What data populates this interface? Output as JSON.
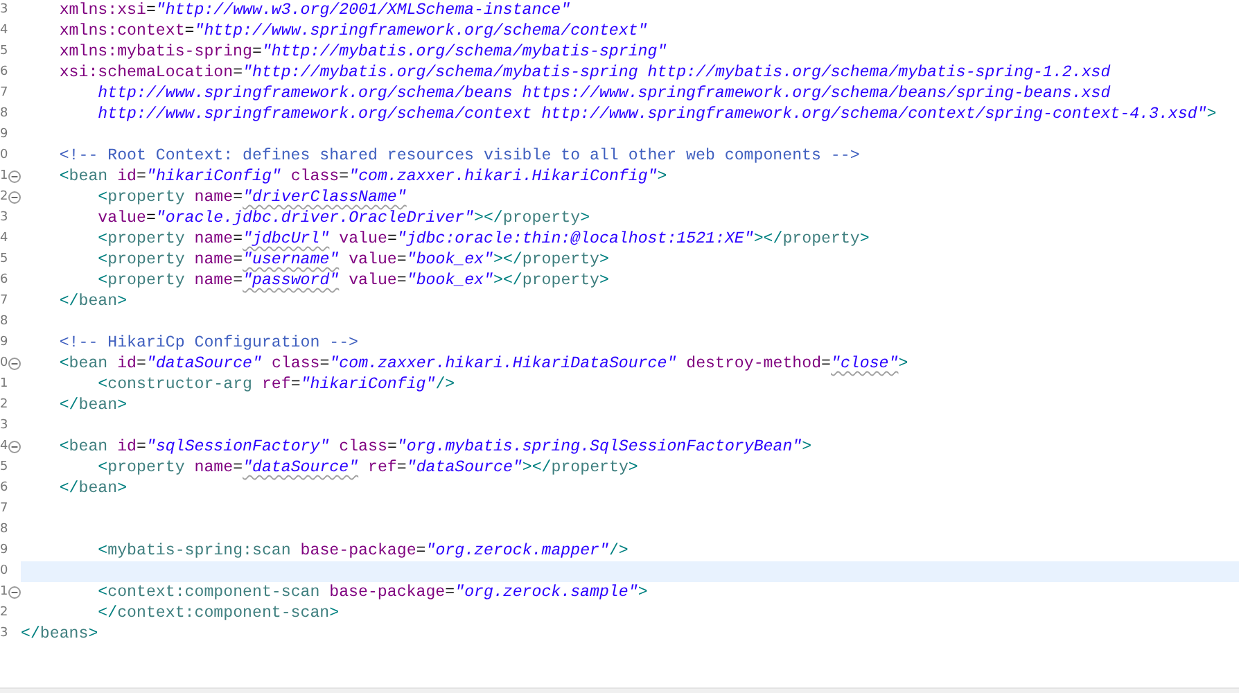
{
  "editor": {
    "lines": [
      {
        "number": "3",
        "foldable": false,
        "current": false,
        "tokens": [
          {
            "kind": "attr",
            "text": "    xmlns:xsi"
          },
          {
            "kind": "plain",
            "text": "="
          },
          {
            "kind": "value",
            "text": "\"http://www.w3.org/2001/XMLSchema-instance\""
          }
        ]
      },
      {
        "number": "4",
        "foldable": false,
        "current": false,
        "tokens": [
          {
            "kind": "attr",
            "text": "    xmlns:context"
          },
          {
            "kind": "plain",
            "text": "="
          },
          {
            "kind": "value",
            "text": "\"http://www.springframework.org/schema/context\""
          }
        ]
      },
      {
        "number": "5",
        "foldable": false,
        "current": false,
        "tokens": [
          {
            "kind": "attr",
            "text": "    xmlns:mybatis-spring"
          },
          {
            "kind": "plain",
            "text": "="
          },
          {
            "kind": "value",
            "text": "\"http://mybatis.org/schema/mybatis-spring\""
          }
        ]
      },
      {
        "number": "6",
        "foldable": false,
        "current": false,
        "tokens": [
          {
            "kind": "attr",
            "text": "    xsi:schemaLocation"
          },
          {
            "kind": "plain",
            "text": "="
          },
          {
            "kind": "value",
            "text": "\"http://mybatis.org/schema/mybatis-spring http://mybatis.org/schema/mybatis-spring-1.2.xsd"
          }
        ]
      },
      {
        "number": "7",
        "foldable": false,
        "current": false,
        "tokens": [
          {
            "kind": "value",
            "text": "        http://www.springframework.org/schema/beans https://www.springframework.org/schema/beans/spring-beans.xsd"
          }
        ]
      },
      {
        "number": "8",
        "foldable": false,
        "current": false,
        "tokens": [
          {
            "kind": "value",
            "text": "        http://www.springframework.org/schema/context http://www.springframework.org/schema/context/spring-context-4.3.xsd\""
          },
          {
            "kind": "bracket",
            "text": ">"
          }
        ]
      },
      {
        "number": "9",
        "foldable": false,
        "current": false
      },
      {
        "number": "0",
        "foldable": false,
        "current": false,
        "tokens": [
          {
            "kind": "comment",
            "text": "    <!-- Root Context: defines shared resources visible to all other web components -->"
          }
        ]
      },
      {
        "number": "1",
        "foldable": true,
        "current": false,
        "tokens": [
          {
            "kind": "bracket",
            "text": "    <"
          },
          {
            "kind": "tag",
            "text": "bean"
          },
          {
            "kind": "attr",
            "text": " id"
          },
          {
            "kind": "plain",
            "text": "="
          },
          {
            "kind": "value",
            "text": "\"hikariConfig\""
          },
          {
            "kind": "attr",
            "text": " class"
          },
          {
            "kind": "plain",
            "text": "="
          },
          {
            "kind": "value",
            "text": "\"com.zaxxer.hikari.HikariConfig\""
          },
          {
            "kind": "bracket",
            "text": ">"
          }
        ]
      },
      {
        "number": "2",
        "foldable": true,
        "current": false,
        "tokens": [
          {
            "kind": "bracket",
            "text": "        <"
          },
          {
            "kind": "tag",
            "text": "property"
          },
          {
            "kind": "attr",
            "text": " name"
          },
          {
            "kind": "plain",
            "text": "="
          },
          {
            "kind": "value",
            "text": "\"driverClassName\"",
            "spell": true
          }
        ]
      },
      {
        "number": "3",
        "foldable": false,
        "current": false,
        "tokens": [
          {
            "kind": "attr",
            "text": "        value"
          },
          {
            "kind": "plain",
            "text": "="
          },
          {
            "kind": "value",
            "text": "\"oracle.jdbc.driver.OracleDriver\""
          },
          {
            "kind": "bracket",
            "text": "></"
          },
          {
            "kind": "tag",
            "text": "property"
          },
          {
            "kind": "bracket",
            "text": ">"
          }
        ]
      },
      {
        "number": "4",
        "foldable": false,
        "current": false,
        "tokens": [
          {
            "kind": "bracket",
            "text": "        <"
          },
          {
            "kind": "tag",
            "text": "property"
          },
          {
            "kind": "attr",
            "text": " name"
          },
          {
            "kind": "plain",
            "text": "="
          },
          {
            "kind": "value",
            "text": "\"jdbcUrl\"",
            "spell": true
          },
          {
            "kind": "attr",
            "text": " value"
          },
          {
            "kind": "plain",
            "text": "="
          },
          {
            "kind": "value",
            "text": "\"jdbc:oracle:thin:@localhost:1521:XE\""
          },
          {
            "kind": "bracket",
            "text": "></"
          },
          {
            "kind": "tag",
            "text": "property"
          },
          {
            "kind": "bracket",
            "text": ">"
          }
        ]
      },
      {
        "number": "5",
        "foldable": false,
        "current": false,
        "tokens": [
          {
            "kind": "bracket",
            "text": "        <"
          },
          {
            "kind": "tag",
            "text": "property"
          },
          {
            "kind": "attr",
            "text": " name"
          },
          {
            "kind": "plain",
            "text": "="
          },
          {
            "kind": "value",
            "text": "\"username\"",
            "spell": true
          },
          {
            "kind": "attr",
            "text": " value"
          },
          {
            "kind": "plain",
            "text": "="
          },
          {
            "kind": "value",
            "text": "\"book_ex\""
          },
          {
            "kind": "bracket",
            "text": "></"
          },
          {
            "kind": "tag",
            "text": "property"
          },
          {
            "kind": "bracket",
            "text": ">"
          }
        ]
      },
      {
        "number": "6",
        "foldable": false,
        "current": false,
        "tokens": [
          {
            "kind": "bracket",
            "text": "        <"
          },
          {
            "kind": "tag",
            "text": "property"
          },
          {
            "kind": "attr",
            "text": " name"
          },
          {
            "kind": "plain",
            "text": "="
          },
          {
            "kind": "value",
            "text": "\"password\"",
            "spell": true
          },
          {
            "kind": "attr",
            "text": " value"
          },
          {
            "kind": "plain",
            "text": "="
          },
          {
            "kind": "value",
            "text": "\"book_ex\""
          },
          {
            "kind": "bracket",
            "text": "></"
          },
          {
            "kind": "tag",
            "text": "property"
          },
          {
            "kind": "bracket",
            "text": ">"
          }
        ]
      },
      {
        "number": "7",
        "foldable": false,
        "current": false,
        "tokens": [
          {
            "kind": "bracket",
            "text": "    </"
          },
          {
            "kind": "tag",
            "text": "bean"
          },
          {
            "kind": "bracket",
            "text": ">"
          }
        ]
      },
      {
        "number": "8",
        "foldable": false,
        "current": false
      },
      {
        "number": "9",
        "foldable": false,
        "current": false,
        "tokens": [
          {
            "kind": "comment",
            "text": "    <!-- HikariCp Configuration -->"
          }
        ]
      },
      {
        "number": "0",
        "foldable": true,
        "current": false,
        "tokens": [
          {
            "kind": "bracket",
            "text": "    <"
          },
          {
            "kind": "tag",
            "text": "bean"
          },
          {
            "kind": "attr",
            "text": " id"
          },
          {
            "kind": "plain",
            "text": "="
          },
          {
            "kind": "value",
            "text": "\"dataSource\""
          },
          {
            "kind": "attr",
            "text": " class"
          },
          {
            "kind": "plain",
            "text": "="
          },
          {
            "kind": "value",
            "text": "\"com.zaxxer.hikari.HikariDataSource\""
          },
          {
            "kind": "attr",
            "text": " destroy-method"
          },
          {
            "kind": "plain",
            "text": "="
          },
          {
            "kind": "value",
            "text": "\"close\"",
            "spell": true
          },
          {
            "kind": "bracket",
            "text": ">"
          }
        ]
      },
      {
        "number": "1",
        "foldable": false,
        "current": false,
        "tokens": [
          {
            "kind": "bracket",
            "text": "        <"
          },
          {
            "kind": "tag",
            "text": "constructor-arg"
          },
          {
            "kind": "attr",
            "text": " ref"
          },
          {
            "kind": "plain",
            "text": "="
          },
          {
            "kind": "value",
            "text": "\"hikariConfig\""
          },
          {
            "kind": "bracket",
            "text": "/>"
          }
        ]
      },
      {
        "number": "2",
        "foldable": false,
        "current": false,
        "tokens": [
          {
            "kind": "bracket",
            "text": "    </"
          },
          {
            "kind": "tag",
            "text": "bean"
          },
          {
            "kind": "bracket",
            "text": ">"
          }
        ]
      },
      {
        "number": "3",
        "foldable": false,
        "current": false
      },
      {
        "number": "4",
        "foldable": true,
        "current": false,
        "tokens": [
          {
            "kind": "bracket",
            "text": "    <"
          },
          {
            "kind": "tag",
            "text": "bean"
          },
          {
            "kind": "attr",
            "text": " id"
          },
          {
            "kind": "plain",
            "text": "="
          },
          {
            "kind": "value",
            "text": "\"sqlSessionFactory\""
          },
          {
            "kind": "attr",
            "text": " class"
          },
          {
            "kind": "plain",
            "text": "="
          },
          {
            "kind": "value",
            "text": "\"org.mybatis.spring.SqlSessionFactoryBean\""
          },
          {
            "kind": "bracket",
            "text": ">"
          }
        ]
      },
      {
        "number": "5",
        "foldable": false,
        "current": false,
        "tokens": [
          {
            "kind": "bracket",
            "text": "        <"
          },
          {
            "kind": "tag",
            "text": "property"
          },
          {
            "kind": "attr",
            "text": " name"
          },
          {
            "kind": "plain",
            "text": "="
          },
          {
            "kind": "value",
            "text": "\"dataSource\"",
            "spell": true
          },
          {
            "kind": "attr",
            "text": " ref"
          },
          {
            "kind": "plain",
            "text": "="
          },
          {
            "kind": "value",
            "text": "\"dataSource\""
          },
          {
            "kind": "bracket",
            "text": "></"
          },
          {
            "kind": "tag",
            "text": "property"
          },
          {
            "kind": "bracket",
            "text": ">"
          }
        ]
      },
      {
        "number": "6",
        "foldable": false,
        "current": false,
        "tokens": [
          {
            "kind": "bracket",
            "text": "    </"
          },
          {
            "kind": "tag",
            "text": "bean"
          },
          {
            "kind": "bracket",
            "text": ">"
          }
        ]
      },
      {
        "number": "7",
        "foldable": false,
        "current": false
      },
      {
        "number": "8",
        "foldable": false,
        "current": false
      },
      {
        "number": "9",
        "foldable": false,
        "current": false,
        "tokens": [
          {
            "kind": "bracket",
            "text": "        <"
          },
          {
            "kind": "tag",
            "text": "mybatis-spring:scan"
          },
          {
            "kind": "attr",
            "text": " base-package"
          },
          {
            "kind": "plain",
            "text": "="
          },
          {
            "kind": "value",
            "text": "\"org.zerock.mapper\""
          },
          {
            "kind": "bracket",
            "text": "/>"
          }
        ]
      },
      {
        "number": "0",
        "foldable": false,
        "current": true
      },
      {
        "number": "1",
        "foldable": true,
        "current": false,
        "tokens": [
          {
            "kind": "bracket",
            "text": "        <"
          },
          {
            "kind": "tag",
            "text": "context:component-scan"
          },
          {
            "kind": "attr",
            "text": " base-package"
          },
          {
            "kind": "plain",
            "text": "="
          },
          {
            "kind": "value",
            "text": "\"org.zerock.sample\""
          },
          {
            "kind": "bracket",
            "text": ">"
          }
        ]
      },
      {
        "number": "2",
        "foldable": false,
        "current": false,
        "tokens": [
          {
            "kind": "bracket",
            "text": "        </"
          },
          {
            "kind": "tag",
            "text": "context:component-scan"
          },
          {
            "kind": "bracket",
            "text": ">"
          }
        ]
      },
      {
        "number": "3",
        "foldable": false,
        "current": false,
        "tokens": [
          {
            "kind": "bracket",
            "text": "</"
          },
          {
            "kind": "tag",
            "text": "beans"
          },
          {
            "kind": "bracket",
            "text": ">"
          }
        ]
      }
    ]
  }
}
